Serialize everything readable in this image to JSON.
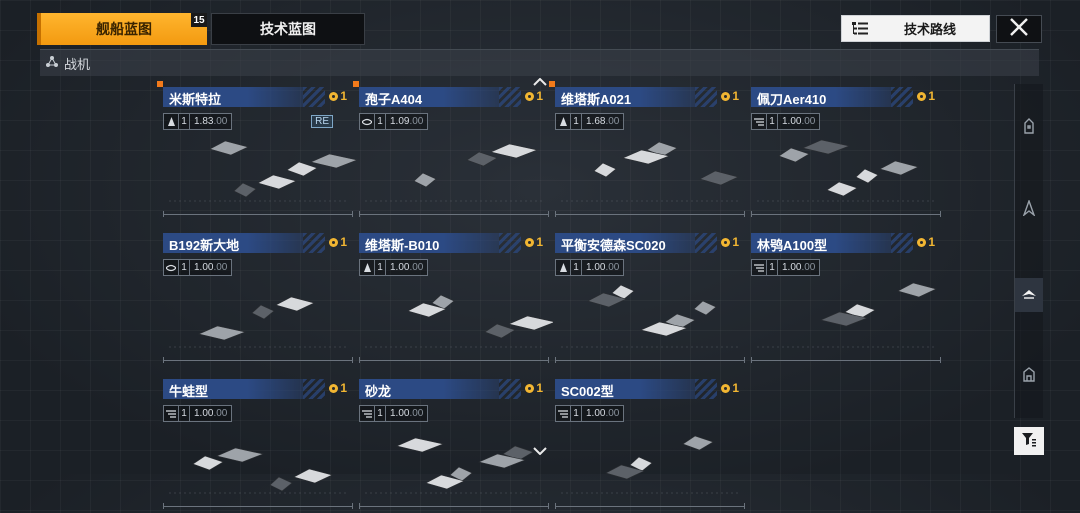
{
  "tabs": [
    {
      "label": "舰船蓝图",
      "badge": "15",
      "active": true
    },
    {
      "label": "技术蓝图",
      "active": false
    }
  ],
  "route_button": {
    "label": "技术路线",
    "icon": "list-tree-icon"
  },
  "close_button": {
    "icon": "close-icon"
  },
  "section": {
    "label": "战机",
    "icon": "molecule-icon"
  },
  "cards": [
    {
      "name": "米斯特拉",
      "count": "1",
      "level": "1",
      "ratio": "1.83",
      "ratio_suffix": ".00",
      "class_icon": "wing-icon",
      "tag": "RE",
      "new_marker": true
    },
    {
      "name": "孢子A404",
      "count": "1",
      "level": "1",
      "ratio": "1.09",
      "ratio_suffix": ".00",
      "class_icon": "hull-icon",
      "tag": "",
      "new_marker": true
    },
    {
      "name": "维塔斯A021",
      "count": "1",
      "level": "1",
      "ratio": "1.68",
      "ratio_suffix": ".00",
      "class_icon": "wing-icon",
      "tag": "",
      "new_marker": true
    },
    {
      "name": "佩刀Aer410",
      "count": "1",
      "level": "1",
      "ratio": "1.00",
      "ratio_suffix": ".00",
      "class_icon": "striped-icon",
      "tag": "",
      "new_marker": false
    },
    {
      "name": "B192新大地",
      "count": "1",
      "level": "1",
      "ratio": "1.00",
      "ratio_suffix": ".00",
      "class_icon": "hull-icon",
      "tag": "",
      "new_marker": false
    },
    {
      "name": "维塔斯-B010",
      "count": "1",
      "level": "1",
      "ratio": "1.00",
      "ratio_suffix": ".00",
      "class_icon": "wing-icon",
      "tag": "",
      "new_marker": false
    },
    {
      "name": "平衡安德森SC020",
      "count": "1",
      "level": "1",
      "ratio": "1.00",
      "ratio_suffix": ".00",
      "class_icon": "wing-icon",
      "tag": "",
      "new_marker": false
    },
    {
      "name": "林鸮A100型",
      "count": "1",
      "level": "1",
      "ratio": "1.00",
      "ratio_suffix": ".00",
      "class_icon": "striped-icon",
      "tag": "",
      "new_marker": false
    },
    {
      "name": "牛蛙型",
      "count": "1",
      "level": "1",
      "ratio": "1.00",
      "ratio_suffix": ".00",
      "class_icon": "striped-icon",
      "tag": "",
      "new_marker": false
    },
    {
      "name": "砂龙",
      "count": "1",
      "level": "1",
      "ratio": "1.00",
      "ratio_suffix": ".00",
      "class_icon": "striped-icon",
      "tag": "",
      "new_marker": false
    },
    {
      "name": "SC002型",
      "count": "1",
      "level": "1",
      "ratio": "1.00",
      "ratio_suffix": ".00",
      "class_icon": "striped-icon",
      "tag": "",
      "new_marker": false
    }
  ],
  "rail": {
    "items": [
      {
        "icon": "battleship-icon",
        "active": false
      },
      {
        "icon": "destroyer-icon",
        "active": false
      },
      {
        "icon": "fighter-icon",
        "active": true
      },
      {
        "icon": "corvette-icon",
        "active": false
      }
    ]
  },
  "filter_button": {
    "icon": "filter-icon"
  },
  "scroll": {
    "up_icon": "chevron-up-icon",
    "down_icon": "chevron-down-icon"
  },
  "colors": {
    "accent": "#f5a623",
    "name_band": "#2c4a84",
    "coin": "#f2b632",
    "marker": "#f17a1b"
  }
}
